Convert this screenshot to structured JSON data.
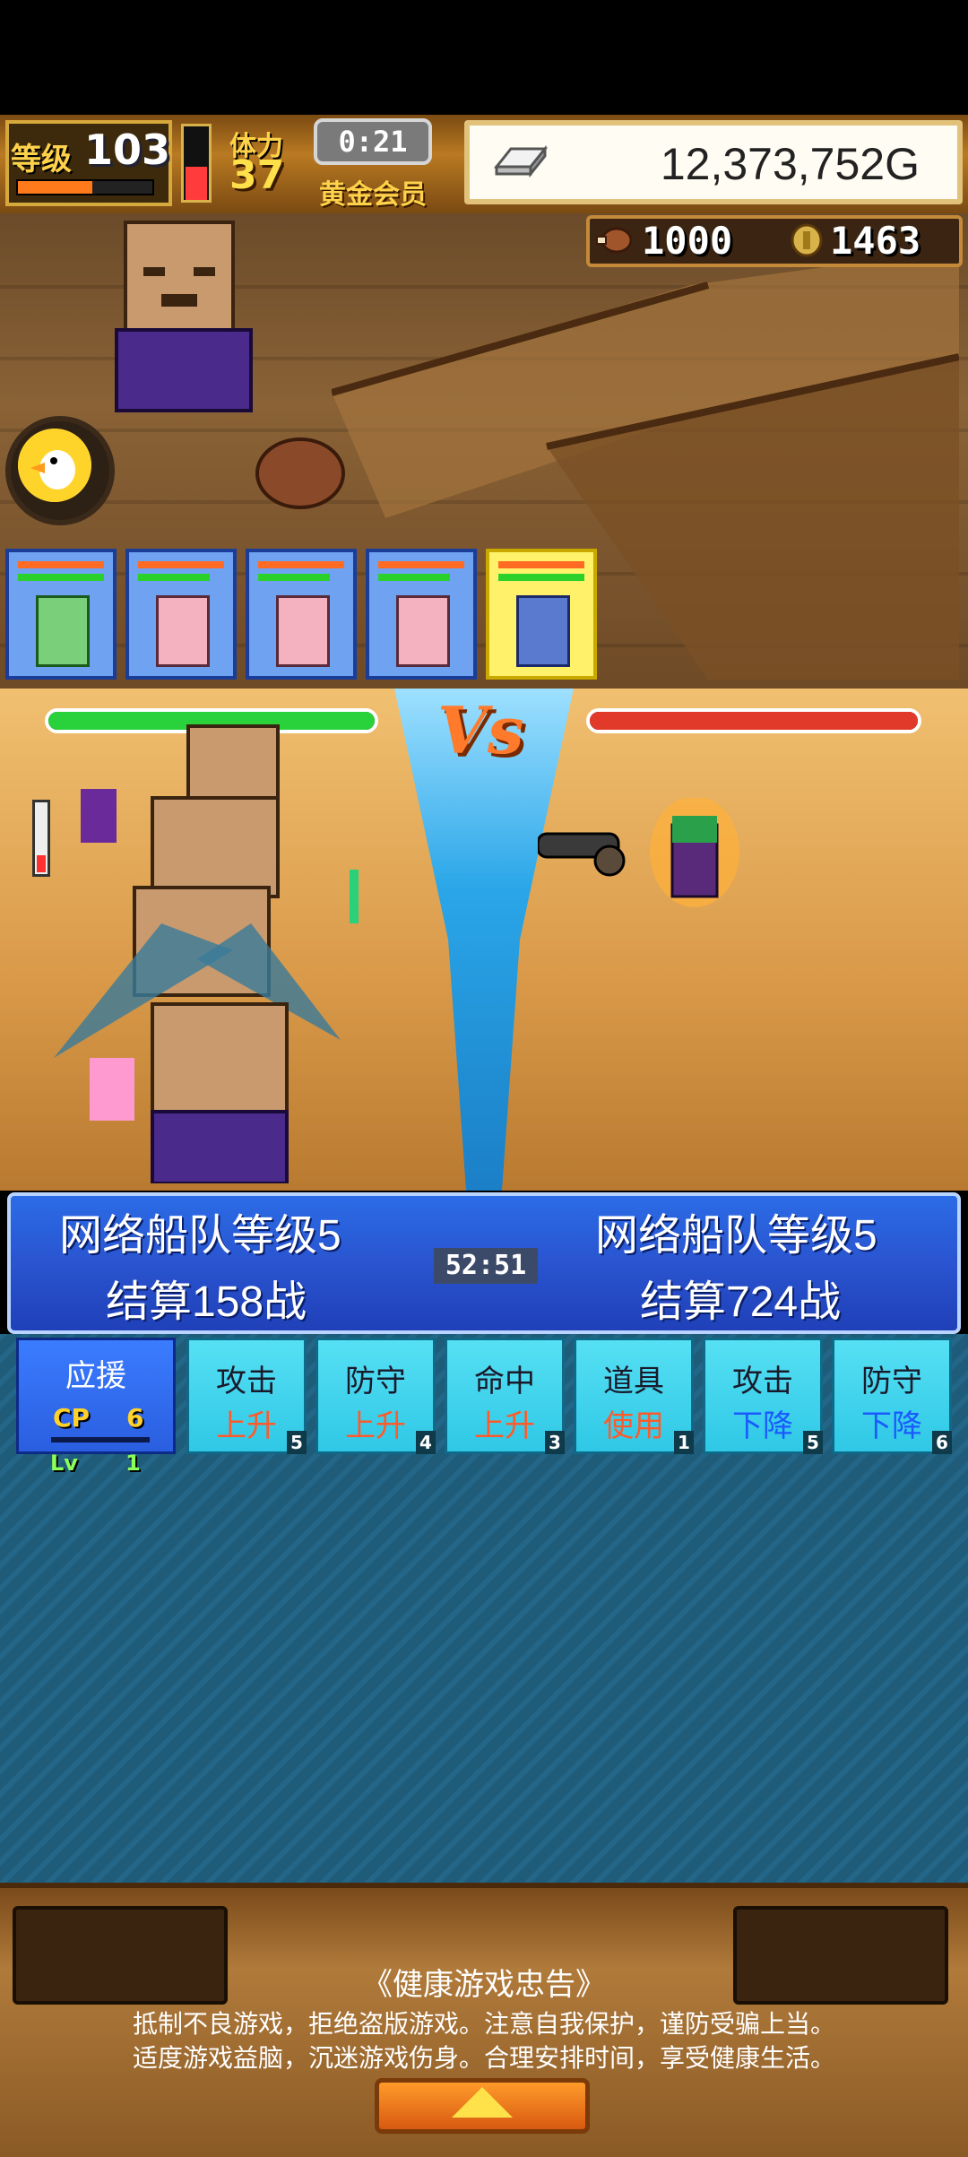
{
  "header": {
    "level_label": "等级",
    "level_value": "103",
    "level_progress": 0.55,
    "stamina_label": "体力",
    "stamina_value": "37",
    "stamina_fill": 0.45,
    "timer": "0:21",
    "vip_label": "黄金会员",
    "gold": "12,373,752G"
  },
  "resources": {
    "meat": "1000",
    "coins": "1463"
  },
  "battle": {
    "vs_label": "Vs",
    "left_hp": 1.0,
    "right_hp": 1.0,
    "left_gauge": 0.25
  },
  "banner": {
    "left_title": "网络船队等级5",
    "left_result": "结算158战",
    "timer": "52:51",
    "right_title": "网络船队等级5",
    "right_result": "结算724战"
  },
  "support": {
    "label": "应援",
    "cp_label": "CP",
    "cp_value": "6",
    "lv_label": "Lv",
    "lv_value": "1"
  },
  "actions": [
    {
      "line1": "攻击",
      "line2": "上升",
      "dir": "up",
      "count": "5"
    },
    {
      "line1": "防守",
      "line2": "上升",
      "dir": "up",
      "count": "4"
    },
    {
      "line1": "命中",
      "line2": "上升",
      "dir": "up",
      "count": "3"
    },
    {
      "line1": "道具",
      "line2": "使用",
      "dir": "up",
      "count": "1"
    },
    {
      "line1": "攻击",
      "line2": "下降",
      "dir": "down",
      "count": "5"
    },
    {
      "line1": "防守",
      "line2": "下降",
      "dir": "down",
      "count": "6"
    }
  ],
  "footer": {
    "advisory_title": "《健康游戏忠告》",
    "advisory_line1": "抵制不良游戏，拒绝盗版游戏。注意自我保护，谨防受骗上当。",
    "advisory_line2": "适度游戏益脑，沉迷游戏伤身。合理安排时间，享受健康生活。"
  },
  "icons": [
    "gold-bar-icon",
    "meat-icon",
    "coin-icon",
    "duck-icon",
    "up-arrow-icon"
  ],
  "colors": {
    "accent_gold": "#ffd24a",
    "hp_green": "#29d13a",
    "hp_red": "#e23a2a",
    "banner_blue": "#2a54d0",
    "button_cyan": "#2fc8e6"
  }
}
